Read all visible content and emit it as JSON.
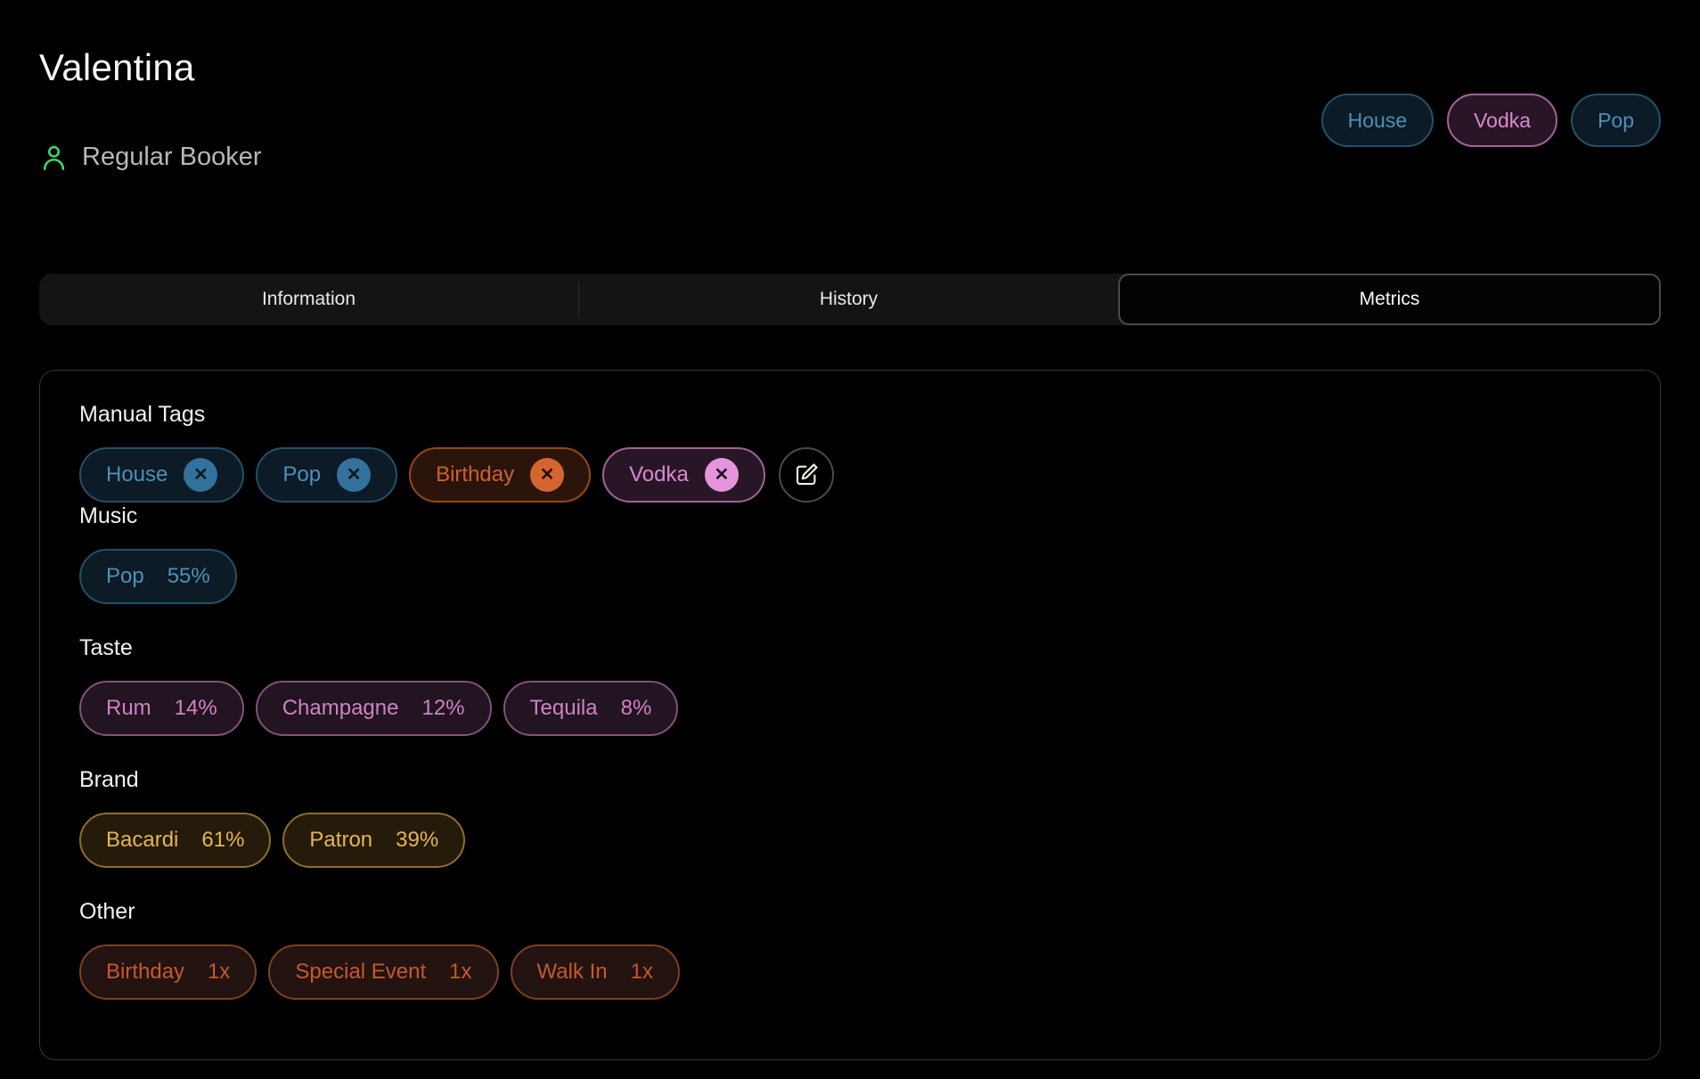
{
  "header": {
    "title": "Valentina",
    "badge": {
      "icon": "person-icon",
      "label": "Regular Booker",
      "color": "#3fd56b"
    },
    "top_tags": [
      {
        "label": "House",
        "theme": "blue"
      },
      {
        "label": "Vodka",
        "theme": "pink"
      },
      {
        "label": "Pop",
        "theme": "blue"
      }
    ]
  },
  "tabs": [
    {
      "label": "Information",
      "active": false
    },
    {
      "label": "History",
      "active": false
    },
    {
      "label": "Metrics",
      "active": true
    }
  ],
  "metrics_panel": {
    "manual_tags": {
      "title": "Manual Tags",
      "tags": [
        {
          "label": "House",
          "theme": "blue"
        },
        {
          "label": "Pop",
          "theme": "blue"
        },
        {
          "label": "Birthday",
          "theme": "orange"
        },
        {
          "label": "Vodka",
          "theme": "pink"
        }
      ],
      "edit_icon": "edit-icon",
      "remove_icon": "remove-icon"
    },
    "sections": [
      {
        "title": "Music",
        "theme": "blue",
        "items": [
          {
            "name": "Pop",
            "value": "55%"
          }
        ]
      },
      {
        "title": "Taste",
        "theme": "pink-soft",
        "items": [
          {
            "name": "Rum",
            "value": "14%"
          },
          {
            "name": "Champagne",
            "value": "12%"
          },
          {
            "name": "Tequila",
            "value": "8%"
          }
        ]
      },
      {
        "title": "Brand",
        "theme": "gold",
        "items": [
          {
            "name": "Bacardi",
            "value": "61%"
          },
          {
            "name": "Patron",
            "value": "39%"
          }
        ]
      },
      {
        "title": "Other",
        "theme": "orange-soft",
        "items": [
          {
            "name": "Birthday",
            "value": "1x"
          },
          {
            "name": "Special Event",
            "value": "1x"
          },
          {
            "name": "Walk In",
            "value": "1x"
          }
        ]
      }
    ]
  },
  "palette": {
    "blue": "#4c90ba",
    "pink": "#d989d2",
    "orange": "#cf6030",
    "pink_soft": "#cf82c4",
    "gold": "#e3b64f",
    "orange_soft": "#c6582c",
    "green": "#3fd56b",
    "background": "#000000"
  }
}
